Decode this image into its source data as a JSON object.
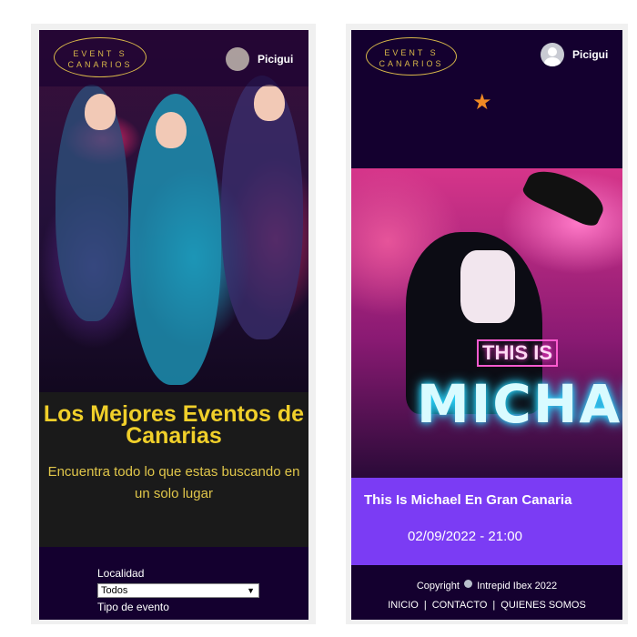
{
  "left_screen": {
    "logo": {
      "line1": "EVENT S",
      "line2": "CANARIOS"
    },
    "username": "Picigui",
    "promo": {
      "title": "Los Mejores Eventos de Canarias",
      "subtitle": "Encuentra todo lo que estas buscando en un solo lugar"
    },
    "filters": {
      "locality_label": "Localidad",
      "locality_value": "Todos",
      "event_type_label": "Tipo de evento"
    }
  },
  "right_screen": {
    "logo": {
      "line1": "EVENT S",
      "line2": "CANARIOS"
    },
    "username": "Picigui",
    "poster": {
      "small_text": "THIS IS",
      "big_text": "MICHAEL"
    },
    "event": {
      "title": "This Is Michael En Gran Canaria",
      "datetime": "02/09/2022 - 21:00"
    },
    "footer": {
      "copyright_prefix": "Copyright",
      "copyright_owner": "Intrepid Ibex 2022",
      "links": [
        "INICIO",
        "CONTACTO",
        "QUIENES SOMOS"
      ]
    }
  },
  "colors": {
    "header_bg": "#14002f",
    "accent_gold": "#f0cf2a",
    "card_purple": "#7b3cf4",
    "star_orange": "#f08a24"
  },
  "icons": [
    "star-icon",
    "user-avatar-icon",
    "copyright-icon",
    "chevron-down-icon"
  ]
}
